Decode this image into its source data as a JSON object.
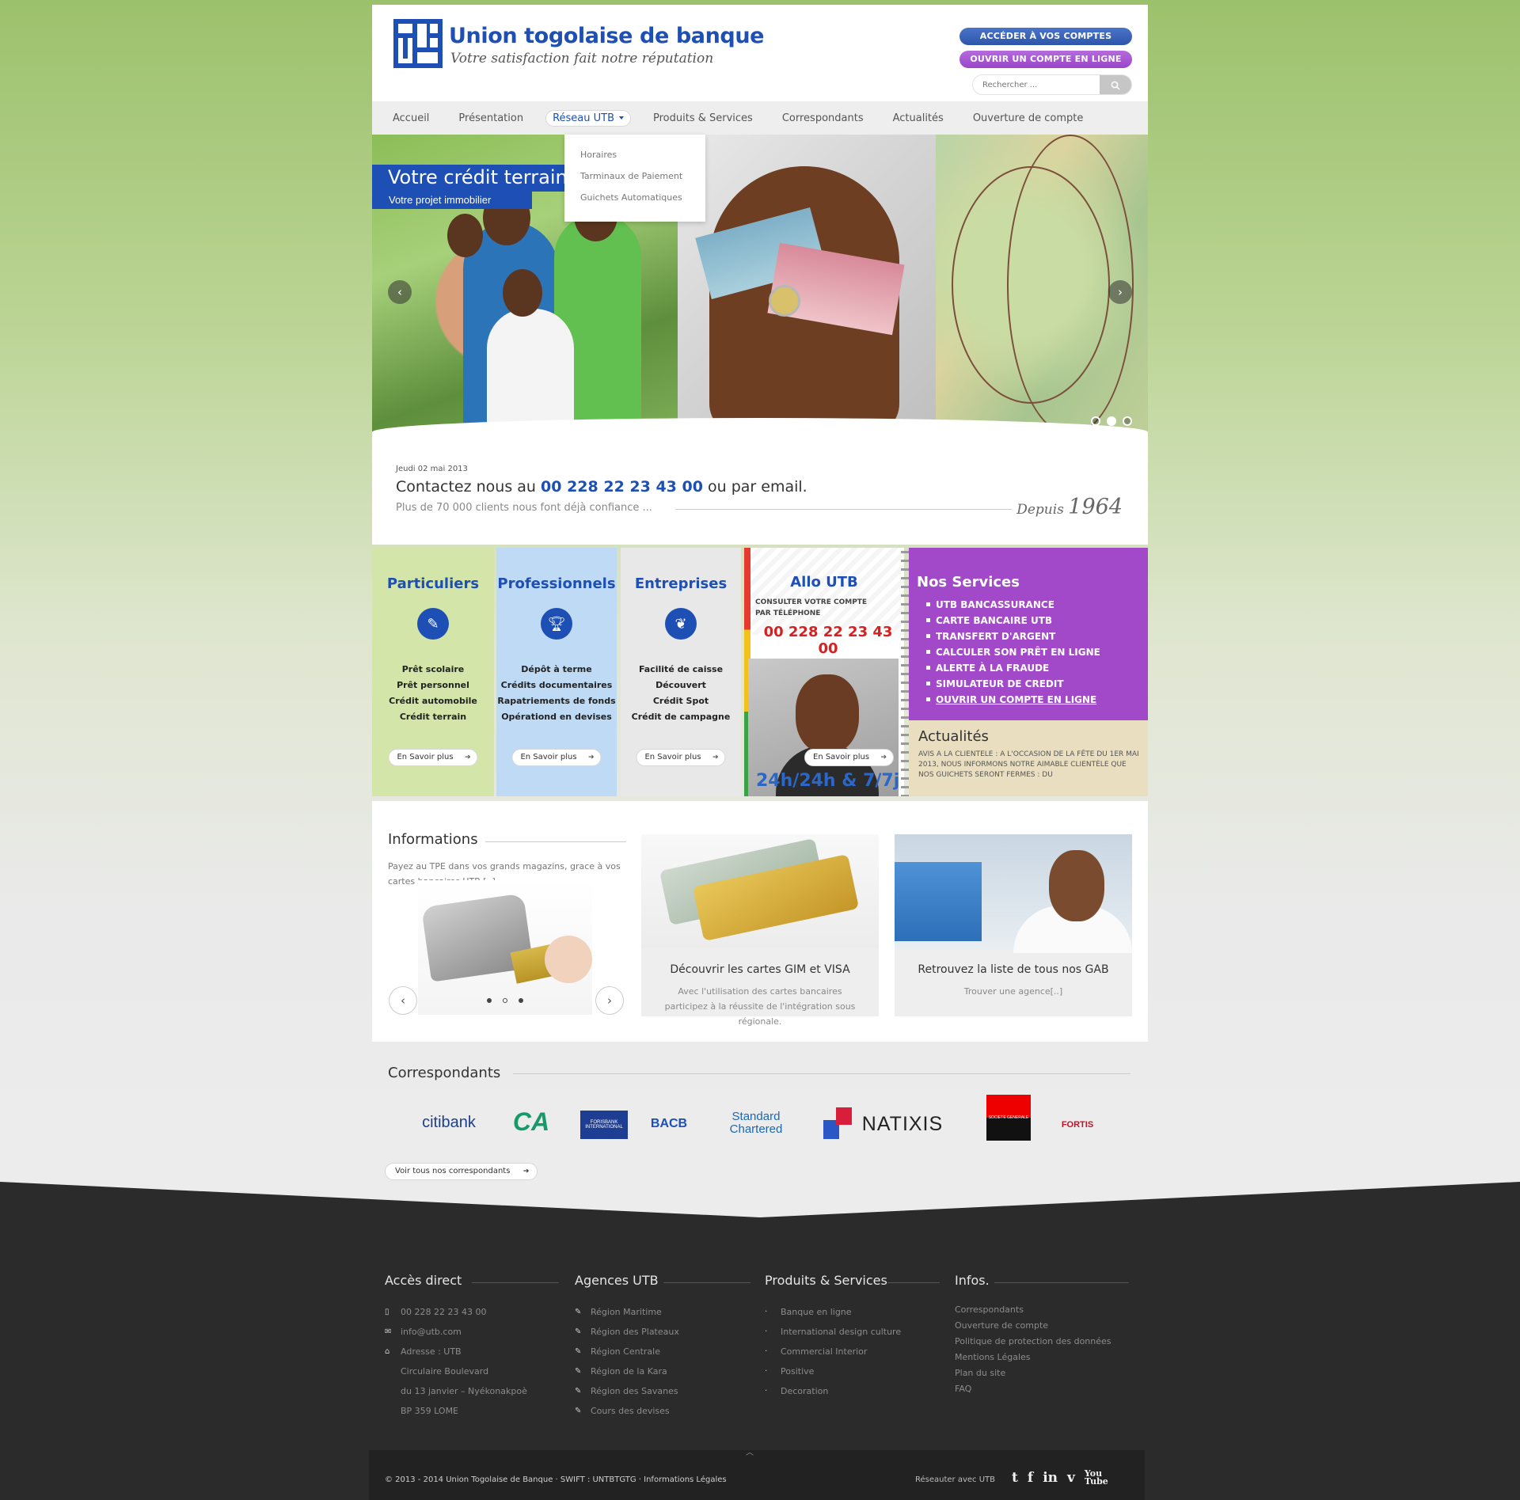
{
  "brand": {
    "name": "Union togolaise de banque",
    "tagline": "Votre satisfaction fait notre réputation",
    "accent": "#1d4fb4",
    "purple": "#a249c9"
  },
  "header": {
    "access_btn": "ACCÉDER À VOS COMPTES",
    "open_btn": "OUVRIR UN COMPTE EN LIGNE",
    "search_placeholder": "Rechercher ..."
  },
  "nav": {
    "items": [
      "Accueil",
      "Présentation",
      "Réseau UTB",
      "Produits & Services",
      "Correspondants",
      "Actualités",
      "Ouverture de compte"
    ],
    "active": "Réseau UTB",
    "dropdown": [
      "Horaires",
      "Tarminaux de Paiement",
      "Guichets Automatiques"
    ]
  },
  "slider": {
    "caption_title": "Votre crédit terrain",
    "caption_sub": "Votre projet immobilier",
    "active_dot": 1
  },
  "infobar": {
    "date": "Jeudi 02 mai 2013",
    "contact_prefix": "Contactez nous au",
    "phone": "00 228 22 23 43 00",
    "contact_suffix": "ou par email.",
    "clients": "Plus de 70 000 clients nous font déjà confiance ...",
    "since_label": "Depuis",
    "since_year": "1964"
  },
  "boxes": {
    "particuliers": {
      "title": "Particuliers",
      "icon": "pencil-icon",
      "items": [
        "Prêt scolaire",
        "Prêt personnel",
        "Crédit automobile",
        "Crédit terrain"
      ],
      "button": "En Savoir plus",
      "bg": "#d3e5a8"
    },
    "professionnels": {
      "title": "Professionnels",
      "icon": "trophy-icon",
      "items": [
        "Dépôt à terme",
        "Crédits documentaires",
        "Rapatriements de fonds",
        "Opérationd en devises"
      ],
      "button": "En Savoir plus",
      "bg": "#bfdaf4"
    },
    "entreprises": {
      "title": "Entreprises",
      "icon": "tulip-icon",
      "items": [
        "Facilité de caisse",
        "Découvert",
        "Crédit Spot",
        "Crédit de campagne"
      ],
      "button": "En Savoir plus",
      "bg": "#e8e8e8"
    },
    "allo": {
      "title": "Allo UTB",
      "sub1": "CONSULTER VOTRE COMPTE",
      "sub2": "PAR TÉLÉPHONE",
      "phone": "00 228 22 23 43 00",
      "button": "En Savoir plus",
      "hours": "24h/24h & 7/7j"
    },
    "services": {
      "title": "Nos Services",
      "items": [
        "UTB BANCASSURANCE",
        "CARTE BANCAIRE UTB",
        "TRANSFERT D'ARGENT",
        "CALCULER SON PRÊT EN LIGNE",
        "ALERTE À LA FRAUDE",
        "SIMULATEUR DE CREDIT",
        "OUVRIR UN COMPTE EN LIGNE"
      ]
    },
    "actualites": {
      "title": "Actualités",
      "text": "AVIS A LA CLIENTELE : A L'OCCASION DE LA FÊTE DU 1er MAI 2013, NOUS INFORMONS NOTRE AIMABLE CLIENTÈLE QUE NOS GUICHETS SERONT FERMES : DU"
    }
  },
  "informations": {
    "title": "Informations",
    "text": "Payez au TPE dans vos grands magazins, grace à vos cartes bancaires UTB [..]",
    "cards": [
      {
        "title": "Découvrir les cartes GIM et VISA",
        "desc": "Avec l'utilisation des cartes bancaires participez à la réussite de l'intégration sous régionale."
      },
      {
        "title": "Retrouvez la liste de tous nos GAB",
        "desc": "Trouver une agence[..]"
      }
    ]
  },
  "correspondants": {
    "title": "Correspondants",
    "logos": [
      "citibank",
      "CA",
      "FORISBANK INTERNATIONAL",
      "BACB",
      "Standard Chartered",
      "NATIXIS",
      "SOCIETE GENERALE",
      "FORTIS"
    ],
    "button": "Voir tous nos correspondants"
  },
  "footer": {
    "acces": {
      "title": "Accès direct",
      "phone": "00 228 22 23 43 00",
      "email": "info@utb.com",
      "address": [
        "Adresse : UTB",
        "Circulaire Boulevard",
        "du 13 janvier – Nyékonakpoè",
        "BP 359 LOME"
      ]
    },
    "agences": {
      "title": "Agences UTB",
      "items": [
        "Région Maritime",
        "Région des Plateaux",
        "Région Centrale",
        "Région de la Kara",
        "Région des Savanes",
        "Cours des devises"
      ]
    },
    "produits": {
      "title": "Produits & Services",
      "items": [
        "Banque en ligne",
        "International design culture",
        "Commercial Interior",
        "Positive",
        "Decoration"
      ]
    },
    "infos": {
      "title": "Infos.",
      "items": [
        "Correspondants",
        "Ouverture de compte",
        "Politique de protection des données",
        "Mentions Légales",
        "Plan du site",
        "FAQ"
      ]
    },
    "copyright": "© 2013 - 2014 Union Togolaise de Banque · SWIFT : UNTBTGTG · Informations Légales",
    "reseau": "Réseauter avec UTB",
    "social": [
      "twitter-icon",
      "facebook-icon",
      "linkedin-icon",
      "vimeo-icon",
      "youtube-icon"
    ]
  }
}
